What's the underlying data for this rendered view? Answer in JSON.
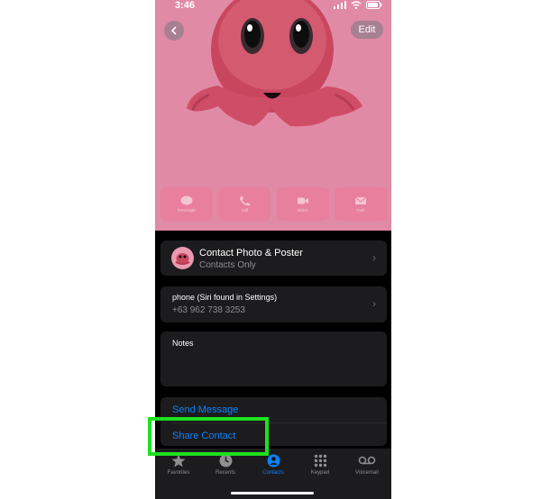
{
  "status": {
    "time": "3:46"
  },
  "header": {
    "edit_label": "Edit"
  },
  "action_buttons": [
    {
      "label": "message",
      "icon": "message-icon"
    },
    {
      "label": "call",
      "icon": "phone-icon"
    },
    {
      "label": "video",
      "icon": "video-icon"
    },
    {
      "label": "mail",
      "icon": "mail-icon"
    }
  ],
  "poster_card": {
    "title": "Contact Photo & Poster",
    "subtitle": "Contacts Only"
  },
  "phone_card": {
    "label": "phone (Siri found in Settings)",
    "number": "+63 962 738 3253"
  },
  "notes_card": {
    "label": "Notes"
  },
  "contact_actions": {
    "send_message": "Send Message",
    "share_contact": "Share Contact"
  },
  "tabbar": {
    "tabs": [
      {
        "label": "Favorites",
        "icon": "star-icon"
      },
      {
        "label": "Recents",
        "icon": "clock-icon"
      },
      {
        "label": "Contacts",
        "icon": "person-icon"
      },
      {
        "label": "Keypad",
        "icon": "keypad-icon"
      },
      {
        "label": "Voicemail",
        "icon": "voicemail-icon"
      }
    ],
    "active": "Contacts"
  },
  "colors": {
    "accent": "#0a84ff",
    "highlight": "#1ee01e",
    "poster_bg": "#e08aa6"
  }
}
